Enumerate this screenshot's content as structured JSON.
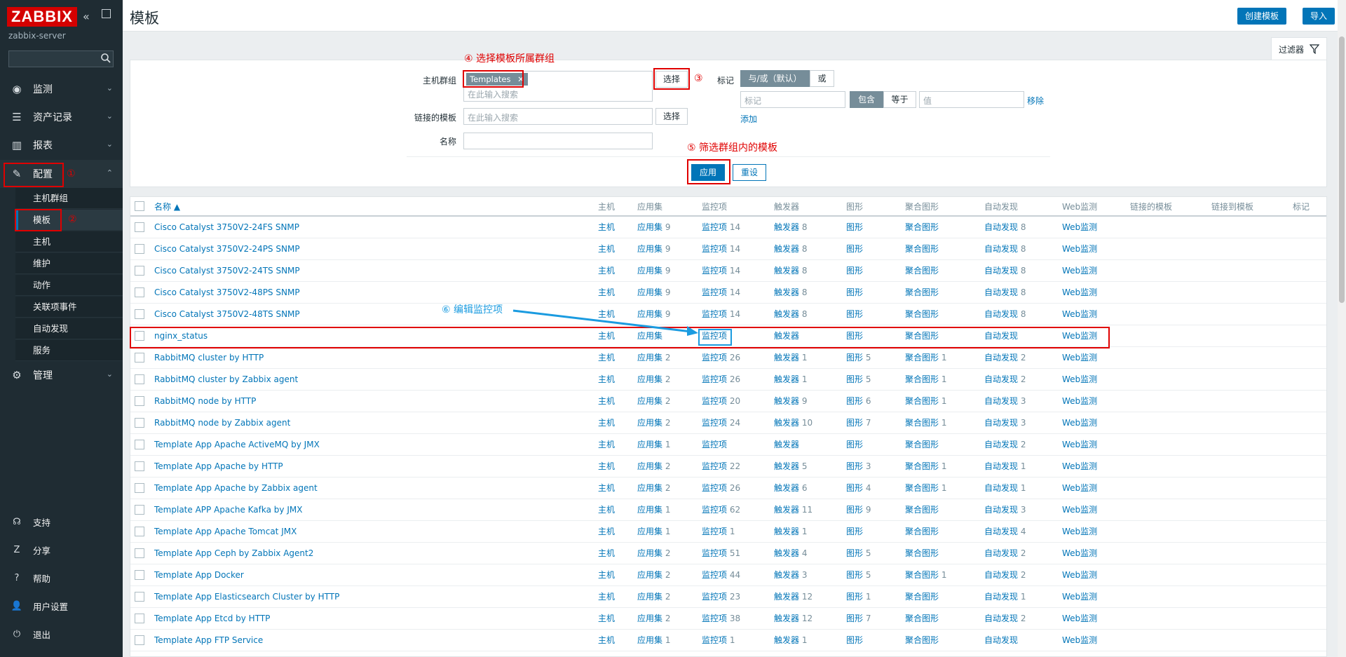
{
  "app": {
    "logo": "ZABBIX",
    "server_name": "zabbix-server",
    "collapse_icon": "«",
    "search_placeholder": ""
  },
  "sidebar": {
    "items": [
      {
        "label": "监测",
        "icon": "eye-icon",
        "glyph": "◉"
      },
      {
        "label": "资产记录",
        "icon": "list-icon",
        "glyph": "☰"
      },
      {
        "label": "报表",
        "icon": "bar-chart-icon",
        "glyph": "▥"
      },
      {
        "label": "配置",
        "icon": "wrench-icon",
        "glyph": "✎"
      },
      {
        "label": "管理",
        "icon": "gear-icon",
        "glyph": "⚙"
      }
    ],
    "config_sub": [
      "主机群组",
      "模板",
      "主机",
      "维护",
      "动作",
      "关联项事件",
      "自动发现",
      "服务"
    ],
    "footer": [
      {
        "label": "支持",
        "icon": "headset-icon",
        "glyph": "☊"
      },
      {
        "label": "分享",
        "icon": "share-icon",
        "glyph": "Z"
      },
      {
        "label": "帮助",
        "icon": "help-icon",
        "glyph": "?"
      },
      {
        "label": "用户设置",
        "icon": "user-icon",
        "glyph": "👤"
      },
      {
        "label": "退出",
        "icon": "power-icon",
        "glyph": "⏻"
      }
    ]
  },
  "header": {
    "title": "模板",
    "create_button": "创建模板",
    "import_button": "导入"
  },
  "filter": {
    "tab_label": "过滤器",
    "host_group_label": "主机群组",
    "host_group_chip": "Templates",
    "host_group_placeholder": "在此输入搜索",
    "select_button": "选择",
    "linked_templates_label": "链接的模板",
    "linked_templates_placeholder": "在此输入搜索",
    "name_label": "名称",
    "name_value": "",
    "tags_label": "标记",
    "tag_and_or": "与/或（默认）",
    "tag_or": "或",
    "tag_placeholder": "标记",
    "tag_contains": "包含",
    "tag_equals": "等于",
    "tag_value_placeholder": "值",
    "tag_remove": "移除",
    "tag_add": "添加",
    "apply_button": "应用",
    "reset_button": "重设"
  },
  "annotations": {
    "a1": "①",
    "a2": "②",
    "a3": "③",
    "a4": "④ 选择模板所属群组",
    "a5": "⑤ 筛选群组内的模板",
    "a6": "⑥ 编辑监控项"
  },
  "table": {
    "headers": {
      "name": "名称 ▲",
      "hosts": "主机",
      "apps": "应用集",
      "items": "监控项",
      "triggers": "触发器",
      "graphs": "图形",
      "screens": "聚合图形",
      "discovery": "自动发现",
      "web": "Web监测",
      "linked": "链接的模板",
      "linked_to": "链接到模板",
      "tags": "标记"
    },
    "rows": [
      {
        "name": "Cisco Catalyst 3750V2-24FS SNMP",
        "hosts": "主机",
        "apps": "应用集",
        "apps_n": "9",
        "items": "监控项",
        "items_n": "14",
        "triggers": "触发器",
        "triggers_n": "8",
        "graphs": "图形",
        "graphs_n": "",
        "screens": "聚合图形",
        "screens_n": "",
        "discovery": "自动发现",
        "discovery_n": "8",
        "web": "Web监测"
      },
      {
        "name": "Cisco Catalyst 3750V2-24PS SNMP",
        "hosts": "主机",
        "apps": "应用集",
        "apps_n": "9",
        "items": "监控项",
        "items_n": "14",
        "triggers": "触发器",
        "triggers_n": "8",
        "graphs": "图形",
        "graphs_n": "",
        "screens": "聚合图形",
        "screens_n": "",
        "discovery": "自动发现",
        "discovery_n": "8",
        "web": "Web监测"
      },
      {
        "name": "Cisco Catalyst 3750V2-24TS SNMP",
        "hosts": "主机",
        "apps": "应用集",
        "apps_n": "9",
        "items": "监控项",
        "items_n": "14",
        "triggers": "触发器",
        "triggers_n": "8",
        "graphs": "图形",
        "graphs_n": "",
        "screens": "聚合图形",
        "screens_n": "",
        "discovery": "自动发现",
        "discovery_n": "8",
        "web": "Web监测"
      },
      {
        "name": "Cisco Catalyst 3750V2-48PS SNMP",
        "hosts": "主机",
        "apps": "应用集",
        "apps_n": "9",
        "items": "监控项",
        "items_n": "14",
        "triggers": "触发器",
        "triggers_n": "8",
        "graphs": "图形",
        "graphs_n": "",
        "screens": "聚合图形",
        "screens_n": "",
        "discovery": "自动发现",
        "discovery_n": "8",
        "web": "Web监测"
      },
      {
        "name": "Cisco Catalyst 3750V2-48TS SNMP",
        "hosts": "主机",
        "apps": "应用集",
        "apps_n": "9",
        "items": "监控项",
        "items_n": "14",
        "triggers": "触发器",
        "triggers_n": "8",
        "graphs": "图形",
        "graphs_n": "",
        "screens": "聚合图形",
        "screens_n": "",
        "discovery": "自动发现",
        "discovery_n": "8",
        "web": "Web监测"
      },
      {
        "name": "nginx_status",
        "hosts": "主机",
        "apps": "应用集",
        "apps_n": "",
        "items": "监控项",
        "items_n": "",
        "triggers": "触发器",
        "triggers_n": "",
        "graphs": "图形",
        "graphs_n": "",
        "screens": "聚合图形",
        "screens_n": "",
        "discovery": "自动发现",
        "discovery_n": "",
        "web": "Web监测"
      },
      {
        "name": "RabbitMQ cluster by HTTP",
        "hosts": "主机",
        "apps": "应用集",
        "apps_n": "2",
        "items": "监控项",
        "items_n": "26",
        "triggers": "触发器",
        "triggers_n": "1",
        "graphs": "图形",
        "graphs_n": "5",
        "screens": "聚合图形",
        "screens_n": "1",
        "discovery": "自动发现",
        "discovery_n": "2",
        "web": "Web监测"
      },
      {
        "name": "RabbitMQ cluster by Zabbix agent",
        "hosts": "主机",
        "apps": "应用集",
        "apps_n": "2",
        "items": "监控项",
        "items_n": "26",
        "triggers": "触发器",
        "triggers_n": "1",
        "graphs": "图形",
        "graphs_n": "5",
        "screens": "聚合图形",
        "screens_n": "1",
        "discovery": "自动发现",
        "discovery_n": "2",
        "web": "Web监测"
      },
      {
        "name": "RabbitMQ node by HTTP",
        "hosts": "主机",
        "apps": "应用集",
        "apps_n": "2",
        "items": "监控项",
        "items_n": "20",
        "triggers": "触发器",
        "triggers_n": "9",
        "graphs": "图形",
        "graphs_n": "6",
        "screens": "聚合图形",
        "screens_n": "1",
        "discovery": "自动发现",
        "discovery_n": "3",
        "web": "Web监测"
      },
      {
        "name": "RabbitMQ node by Zabbix agent",
        "hosts": "主机",
        "apps": "应用集",
        "apps_n": "2",
        "items": "监控项",
        "items_n": "24",
        "triggers": "触发器",
        "triggers_n": "10",
        "graphs": "图形",
        "graphs_n": "7",
        "screens": "聚合图形",
        "screens_n": "1",
        "discovery": "自动发现",
        "discovery_n": "3",
        "web": "Web监测"
      },
      {
        "name": "Template App Apache ActiveMQ by JMX",
        "hosts": "主机",
        "apps": "应用集",
        "apps_n": "1",
        "items": "监控项",
        "items_n": "",
        "triggers": "触发器",
        "triggers_n": "",
        "graphs": "图形",
        "graphs_n": "",
        "screens": "聚合图形",
        "screens_n": "",
        "discovery": "自动发现",
        "discovery_n": "2",
        "web": "Web监测"
      },
      {
        "name": "Template App Apache by HTTP",
        "hosts": "主机",
        "apps": "应用集",
        "apps_n": "2",
        "items": "监控项",
        "items_n": "22",
        "triggers": "触发器",
        "triggers_n": "5",
        "graphs": "图形",
        "graphs_n": "3",
        "screens": "聚合图形",
        "screens_n": "1",
        "discovery": "自动发现",
        "discovery_n": "1",
        "web": "Web监测"
      },
      {
        "name": "Template App Apache by Zabbix agent",
        "hosts": "主机",
        "apps": "应用集",
        "apps_n": "2",
        "items": "监控项",
        "items_n": "26",
        "triggers": "触发器",
        "triggers_n": "6",
        "graphs": "图形",
        "graphs_n": "4",
        "screens": "聚合图形",
        "screens_n": "1",
        "discovery": "自动发现",
        "discovery_n": "1",
        "web": "Web监测"
      },
      {
        "name": "Template APP Apache Kafka by JMX",
        "hosts": "主机",
        "apps": "应用集",
        "apps_n": "1",
        "items": "监控项",
        "items_n": "62",
        "triggers": "触发器",
        "triggers_n": "11",
        "graphs": "图形",
        "graphs_n": "9",
        "screens": "聚合图形",
        "screens_n": "",
        "discovery": "自动发现",
        "discovery_n": "3",
        "web": "Web监测"
      },
      {
        "name": "Template App Apache Tomcat JMX",
        "hosts": "主机",
        "apps": "应用集",
        "apps_n": "1",
        "items": "监控项",
        "items_n": "1",
        "triggers": "触发器",
        "triggers_n": "1",
        "graphs": "图形",
        "graphs_n": "",
        "screens": "聚合图形",
        "screens_n": "",
        "discovery": "自动发现",
        "discovery_n": "4",
        "web": "Web监测"
      },
      {
        "name": "Template App Ceph by Zabbix Agent2",
        "hosts": "主机",
        "apps": "应用集",
        "apps_n": "2",
        "items": "监控项",
        "items_n": "51",
        "triggers": "触发器",
        "triggers_n": "4",
        "graphs": "图形",
        "graphs_n": "5",
        "screens": "聚合图形",
        "screens_n": "",
        "discovery": "自动发现",
        "discovery_n": "2",
        "web": "Web监测"
      },
      {
        "name": "Template App Docker",
        "hosts": "主机",
        "apps": "应用集",
        "apps_n": "2",
        "items": "监控项",
        "items_n": "44",
        "triggers": "触发器",
        "triggers_n": "3",
        "graphs": "图形",
        "graphs_n": "5",
        "screens": "聚合图形",
        "screens_n": "1",
        "discovery": "自动发现",
        "discovery_n": "2",
        "web": "Web监测"
      },
      {
        "name": "Template App Elasticsearch Cluster by HTTP",
        "hosts": "主机",
        "apps": "应用集",
        "apps_n": "2",
        "items": "监控项",
        "items_n": "23",
        "triggers": "触发器",
        "triggers_n": "12",
        "graphs": "图形",
        "graphs_n": "1",
        "screens": "聚合图形",
        "screens_n": "",
        "discovery": "自动发现",
        "discovery_n": "1",
        "web": "Web监测"
      },
      {
        "name": "Template App Etcd by HTTP",
        "hosts": "主机",
        "apps": "应用集",
        "apps_n": "2",
        "items": "监控项",
        "items_n": "38",
        "triggers": "触发器",
        "triggers_n": "12",
        "graphs": "图形",
        "graphs_n": "7",
        "screens": "聚合图形",
        "screens_n": "",
        "discovery": "自动发现",
        "discovery_n": "2",
        "web": "Web监测"
      },
      {
        "name": "Template App FTP Service",
        "hosts": "主机",
        "apps": "应用集",
        "apps_n": "1",
        "items": "监控项",
        "items_n": "1",
        "triggers": "触发器",
        "triggers_n": "1",
        "graphs": "图形",
        "graphs_n": "",
        "screens": "聚合图形",
        "screens_n": "",
        "discovery": "自动发现",
        "discovery_n": "",
        "web": "Web监测"
      }
    ]
  },
  "colors": {
    "sidebar_bg": "#1f2c33",
    "accent": "#0275b8",
    "annotation_red": "#e00000",
    "annotation_blue": "#1a9be0"
  }
}
